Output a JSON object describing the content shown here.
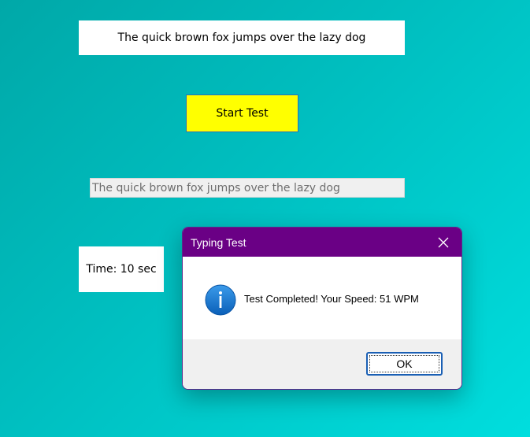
{
  "main": {
    "sample_text": "The quick brown fox jumps over the lazy dog",
    "start_button_label": "Start Test",
    "input_value": "The quick brown fox jumps over the lazy dog",
    "timer_text": "Time: 10 sec",
    "start_button_color": "#ffff00"
  },
  "dialog": {
    "title": "Typing Test",
    "message": "Test Completed! Your Speed: 51 WPM",
    "ok_label": "OK",
    "icon": "info-icon",
    "title_bar_color": "#6a0085"
  }
}
